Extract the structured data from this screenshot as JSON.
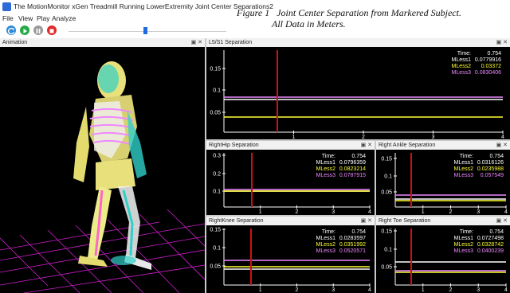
{
  "window": {
    "title": "The MotionMonitor xGen Treadmill Running LowerExtremity Joint Center Separations2"
  },
  "caption": {
    "line1": "Figure 1   Joint Center Separation from Markered Subject.",
    "line2": "All Data in Meters."
  },
  "menu": [
    "File",
    "View",
    "Play",
    "Analyze"
  ],
  "colors": {
    "mless1": "#ffffff",
    "mless2": "#ffff33",
    "mless3": "#ee88ff",
    "cursor": "#cc1111",
    "grid_bg": "#000000"
  },
  "panes": {
    "animation": {
      "title": "Animation"
    },
    "l5s1": {
      "title": "L5/S1 Separation",
      "time_label": "Time:",
      "time": "0.754",
      "legend": [
        {
          "name": "MLess1",
          "value": "0.0779916"
        },
        {
          "name": "MLess2",
          "value": "0.03372"
        },
        {
          "name": "MLess3",
          "value": "0.0830406"
        }
      ],
      "yticks": [
        "0.15",
        "0.1",
        "0.05"
      ],
      "xticks": [
        "1",
        "2",
        "3",
        "4"
      ]
    },
    "right_hip": {
      "title": "RightHip Separation",
      "time_label": "Time:",
      "time": "0.754",
      "legend": [
        {
          "name": "MLess1",
          "value": "0.0796359"
        },
        {
          "name": "MLess2",
          "value": "0.0823214"
        },
        {
          "name": "MLess3",
          "value": "0.0787915"
        }
      ],
      "yticks": [
        "0.3",
        "0.2",
        "0.1"
      ],
      "xticks": [
        "1",
        "2",
        "3",
        "4"
      ]
    },
    "right_ankle": {
      "title": "Right Ankle Separation",
      "time_label": "Time:",
      "time": "0.754",
      "legend": [
        {
          "name": "MLess1",
          "value": "0.0316126"
        },
        {
          "name": "MLess2",
          "value": "0.0235988"
        },
        {
          "name": "MLess3",
          "value": "0.057549"
        }
      ],
      "yticks": [
        "0.15",
        "0.1",
        "0.05"
      ],
      "xticks": [
        "1",
        "2",
        "3",
        "4"
      ]
    },
    "right_knee": {
      "title": "RightKnee Separation",
      "time_label": "Time:",
      "time": "0.754",
      "legend": [
        {
          "name": "MLess1",
          "value": "0.0283597"
        },
        {
          "name": "MLess2",
          "value": "0.0351992"
        },
        {
          "name": "MLess3",
          "value": "0.0520571"
        }
      ],
      "yticks": [
        "0.15",
        "0.1",
        "0.05"
      ],
      "xticks": [
        "1",
        "2",
        "3",
        "4"
      ]
    },
    "right_toe": {
      "title": "Right Toe Separation",
      "time_label": "Time:",
      "time": "0.754",
      "legend": [
        {
          "name": "MLess1",
          "value": "0.0727498"
        },
        {
          "name": "MLess2",
          "value": "0.0328742"
        },
        {
          "name": "MLess3",
          "value": "0.0400239"
        }
      ],
      "yticks": [
        "0.15",
        "0.1",
        "0.05"
      ],
      "xticks": [
        "1",
        "2",
        "3",
        "4"
      ]
    }
  }
}
